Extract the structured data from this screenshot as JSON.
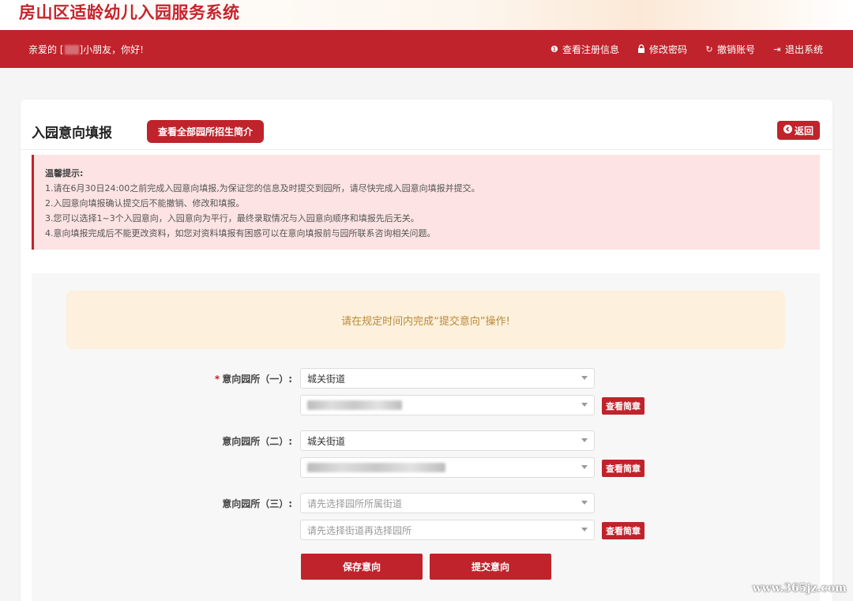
{
  "header": {
    "app_title": "房山区适龄幼儿入园服务系统"
  },
  "navbar": {
    "greeting_prefix": "亲爱的 [",
    "greeting_suffix": "]小朋友，你好!",
    "links": [
      {
        "label": "查看注册信息",
        "icon": "info-icon",
        "glyph": "❶"
      },
      {
        "label": "修改密码",
        "icon": "lock-icon",
        "glyph": "🔒"
      },
      {
        "label": "撤销账号",
        "icon": "refresh-icon",
        "glyph": "↻"
      },
      {
        "label": "退出系统",
        "icon": "logout-icon",
        "glyph": "⇥"
      }
    ]
  },
  "page": {
    "title": "入园意向填报",
    "intro_button": "查看全部园所招生简介",
    "back_button": "返回"
  },
  "notice": {
    "title": "温馨提示:",
    "lines": [
      "1.请在6月30日24:00之前完成入园意向填报,为保证您的信息及时提交到园所，请尽快完成入园意向填报并提交。",
      "2.入园意向填报确认提交后不能撤销、修改和填报。",
      "3.您可以选择1~3个入园意向，入园意向为平行，最终录取情况与入园意向顺序和填报先后无关。",
      "4.意向填报完成后不能更改资料，如您对资料填报有困惑可以在意向填报前与园所联系咨询相关问题。"
    ]
  },
  "alert": {
    "text": "请在规定时间内完成“提交意向”操作!"
  },
  "intentions": [
    {
      "label": "意向园所（一）:",
      "required": "*",
      "street": "城关街道",
      "kindergarten": "",
      "view_button": "查看简章"
    },
    {
      "label": "意向园所（二）:",
      "required": "",
      "street": "城关街道",
      "kindergarten": "",
      "view_button": "查看简章"
    },
    {
      "label": "意向园所（三）:",
      "required": "",
      "street": "请先选择园所所属街道",
      "kindergarten": "请先选择街道再选择园所",
      "view_button": "查看简章"
    }
  ],
  "actions": {
    "save": "保存意向",
    "submit": "提交意向"
  },
  "watermark": "www.365jz.com",
  "colors": {
    "brand_red": "#c0232b",
    "notice_bg": "#fde3e3",
    "alert_bg": "#fdf0dc",
    "alert_text": "#b98a3a"
  }
}
